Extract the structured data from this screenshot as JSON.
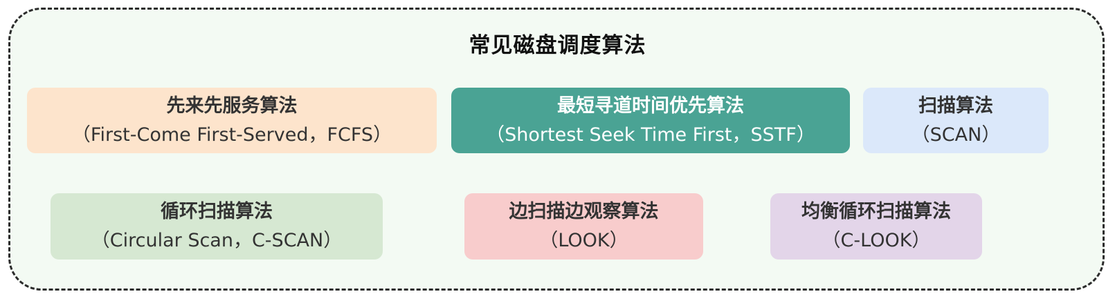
{
  "title": "常见磁盘调度算法",
  "colors": {
    "frame_bg": "#f3faf3",
    "frame_border": "#2b2b2b",
    "fcfs_bg": "#fde4cc",
    "sstf_bg": "#4aa394",
    "scan_bg": "#dbe8fa",
    "cscan_bg": "#d6e8d2",
    "look_bg": "#f8cccc",
    "clook_bg": "#e3d5e9"
  },
  "algorithms": [
    {
      "name": "先来先服务算法",
      "english": "（First-Come First-Served，FCFS）"
    },
    {
      "name": "最短寻道时间优先算法",
      "english": "（Shortest Seek Time First，SSTF）"
    },
    {
      "name": "扫描算法",
      "english": "（SCAN）"
    },
    {
      "name": "循环扫描算法",
      "english": "（Circular Scan，C-SCAN）"
    },
    {
      "name": "边扫描边观察算法",
      "english": "（LOOK）"
    },
    {
      "name": "均衡循环扫描算法",
      "english": "（C-LOOK）"
    }
  ]
}
